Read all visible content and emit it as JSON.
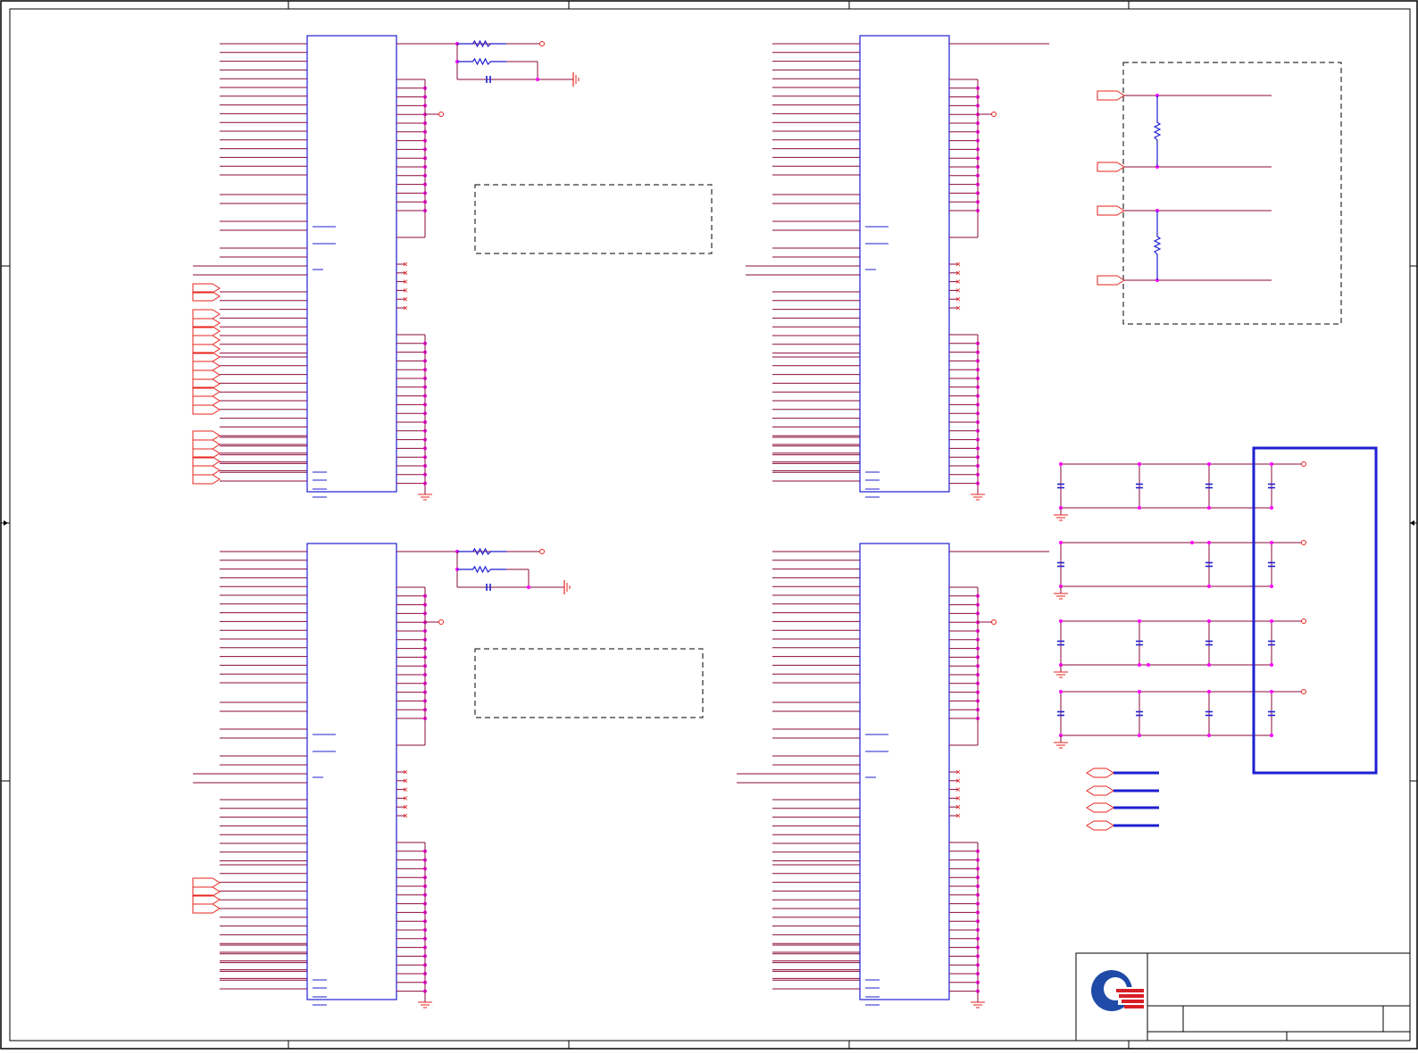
{
  "sheet": {
    "title_block": {
      "company_logo": "quanta-logo",
      "title": "",
      "document_number": "",
      "revision": ""
    }
  },
  "colors": {
    "border": "#000000",
    "wire": "#8b0a3c",
    "pin_red": "#e8231e",
    "component_blue": "#1f1fd2",
    "junction": "#ff00ff",
    "dashed_box": "#000000",
    "logo_blue": "#1f4aa8",
    "logo_red": "#d81f26"
  },
  "blocks": [
    {
      "id": "u-top-left"
    },
    {
      "id": "u-top-right"
    },
    {
      "id": "u-bottom-left"
    },
    {
      "id": "u-bottom-right"
    }
  ],
  "icons": {
    "ground": "ground-icon",
    "resistor": "resistor-icon",
    "capacitor": "capacitor-icon",
    "off_page_connector": "off-page-connector-icon",
    "no_connect": "no-connect-icon"
  }
}
